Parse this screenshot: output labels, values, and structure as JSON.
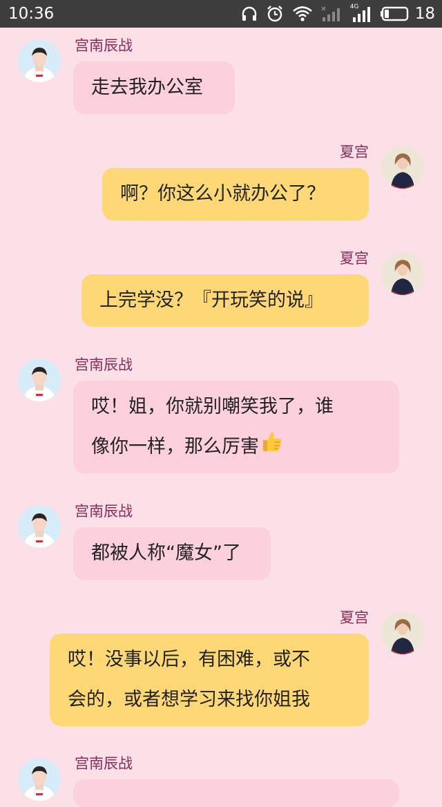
{
  "status_bar": {
    "time": "10:36",
    "battery_level": "18",
    "network_label": "4G",
    "icons": [
      "headphones-icon",
      "alarm-icon",
      "wifi-icon",
      "signal-icon",
      "battery-icon"
    ]
  },
  "participants": {
    "left_name": "宫南辰战",
    "right_name": "夏宫"
  },
  "messages": [
    {
      "side": "left",
      "sender": "宫南辰战",
      "lines": [
        "走去我办公室"
      ]
    },
    {
      "side": "right",
      "sender": "夏宫",
      "lines": [
        "啊？你这么小就办公了？"
      ]
    },
    {
      "side": "right",
      "sender": "夏宫",
      "lines": [
        "上完学没？『开玩笑的说』"
      ]
    },
    {
      "side": "left",
      "sender": "宫南辰战",
      "lines": [
        "哎！姐，你就别嘲笑我了，谁",
        "像你一样，那么厉害"
      ],
      "emoji": "thumbs-up-icon"
    },
    {
      "side": "left",
      "sender": "宫南辰战",
      "lines": [
        "都被人称“魔女”了"
      ]
    },
    {
      "side": "right",
      "sender": "夏宫",
      "lines": [
        "哎！没事以后，有困难，或不",
        "会的，或者想学习来找你姐我"
      ]
    },
    {
      "side": "left",
      "sender": "宫南辰战",
      "lines": []
    }
  ],
  "colors": {
    "background": "#fbe1e7",
    "left_bubble": "#fdd0dd",
    "right_bubble": "#ffd876",
    "name_text": "#8a2a59",
    "status_bar": "#3d3d3d"
  }
}
